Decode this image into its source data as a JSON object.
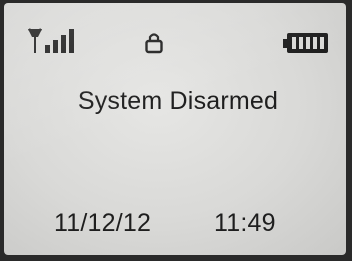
{
  "status_bar": {
    "signal_icon": "signal-strength-icon",
    "lock_icon": "lock-icon",
    "battery_icon": "battery-full-icon"
  },
  "display": {
    "status_message": "System Disarmed",
    "date": "11/12/12",
    "time": "11:49"
  },
  "colors": {
    "lcd_background": "#dcdcda",
    "lcd_text": "#1e1e1e",
    "bezel": "#2a2a2a"
  }
}
